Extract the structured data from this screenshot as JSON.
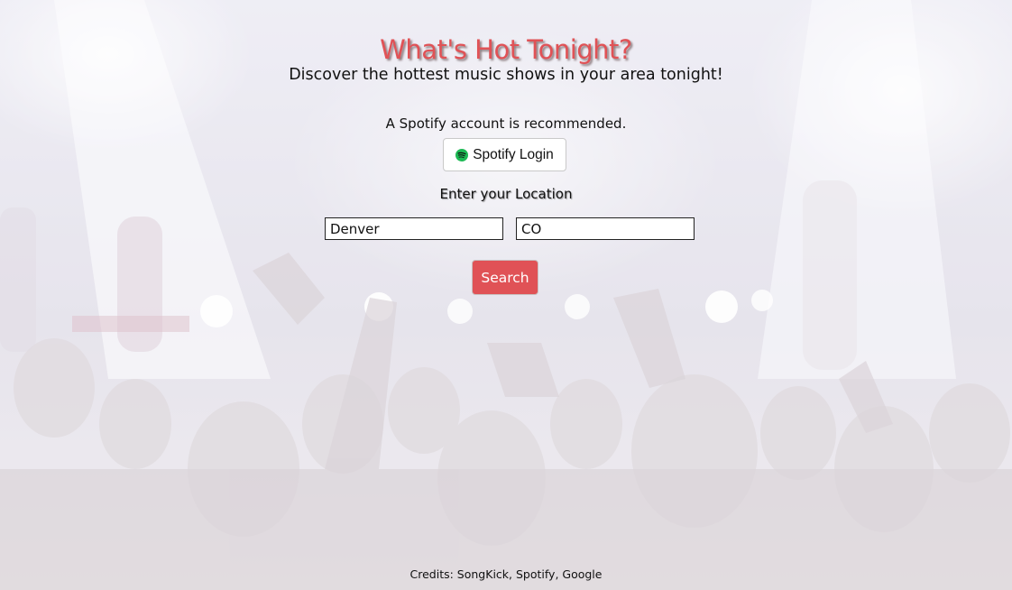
{
  "header": {
    "title": "What's Hot Tonight?",
    "subtitle": "Discover the hottest music shows in your area tonight!"
  },
  "spotify": {
    "recommendation": "A Spotify account is recommended.",
    "login_label": "Spotify Login",
    "icon": "spotify-icon"
  },
  "location": {
    "label": "Enter your Location",
    "city_value": "Denver",
    "state_value": "CO"
  },
  "search": {
    "label": "Search"
  },
  "footer": {
    "credits": "Credits: SongKick, Spotify, Google"
  },
  "colors": {
    "accent": "#e05256",
    "spotify_green": "#1db954"
  }
}
